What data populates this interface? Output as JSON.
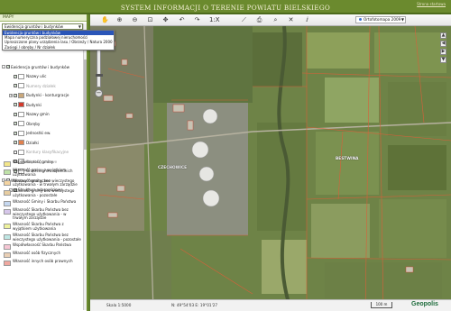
{
  "header": {
    "title": "SYSTEM INFORMACJI O TERENIE POWIATU BIELSKIEGO",
    "home_link": "Strona startowa"
  },
  "sidebar": {
    "tab": "MAPY",
    "selected_map": "Ewidencja gruntów i budynków",
    "options": [
      "Ewidencja gruntów i budynków",
      "Mapa numeryczna podziałowej nieruchomości",
      "Uproszczone plany urządzenia lasu / Obrzeży / Natura 2000",
      "Zasięgi / obręby / Nr działek"
    ],
    "tree": [
      {
        "level": 0,
        "label": "Ewidencja gruntów i budynków",
        "grey": false,
        "checked": true,
        "exp": "-",
        "swatch": ""
      },
      {
        "level": 1,
        "label": "Nazwy ulic",
        "grey": false,
        "checked": true,
        "exp": "",
        "swatch": "#ffffff"
      },
      {
        "level": 1,
        "label": "Numery działek",
        "grey": true,
        "checked": true,
        "exp": "",
        "swatch": "#ffffff"
      },
      {
        "level": 1,
        "label": "Budynki - konturgracje",
        "grey": false,
        "checked": true,
        "exp": "+",
        "swatch": "#c9a77a"
      },
      {
        "level": 1,
        "label": "Budynki",
        "grey": false,
        "checked": true,
        "exp": "",
        "swatch": "#d33a2c"
      },
      {
        "level": 1,
        "label": "Nazwy gmin",
        "grey": false,
        "checked": true,
        "exp": "",
        "swatch": "#ffffff"
      },
      {
        "level": 1,
        "label": "Obręby",
        "grey": false,
        "checked": true,
        "exp": "",
        "swatch": "#ffffff"
      },
      {
        "level": 1,
        "label": "Jednostki ew.",
        "grey": false,
        "checked": true,
        "exp": "",
        "swatch": "#ffffff"
      },
      {
        "level": 1,
        "label": "Działki",
        "grey": false,
        "checked": true,
        "exp": "",
        "swatch": "#e0814e"
      },
      {
        "level": 1,
        "label": "Kontury klasyfikacyjne",
        "grey": true,
        "checked": false,
        "exp": "",
        "swatch": "#ffffff"
      },
      {
        "level": 1,
        "label": "Użytki gruntowe",
        "grey": true,
        "checked": false,
        "exp": "",
        "swatch": "#ffffff"
      },
      {
        "level": 1,
        "label": "Granice gmin sąsiednich",
        "grey": false,
        "checked": true,
        "exp": "",
        "swatch": "#ffffff"
      },
      {
        "level": 0,
        "label": "Warstwy tematyczne",
        "grey": false,
        "checked": false,
        "exp": "-",
        "swatch": ""
      },
      {
        "level": 1,
        "label": "Struktura własnościowa",
        "grey": false,
        "checked": true,
        "exp": "-",
        "swatch": ""
      }
    ],
    "legend": [
      {
        "color": "#f3e68a",
        "label": "Współwłasność gminy"
      },
      {
        "color": "#bfe2a8",
        "label": "Własność gminy z wyjątkiem użytkowania"
      },
      {
        "color": "#f4d4a1",
        "label": "Własność gminy bez wieczystego użytkowania - w trwałym zarządzie"
      },
      {
        "color": "#e7cda1",
        "label": "Własność gminy bez wieczystego użytkowania - pozostałe"
      },
      {
        "color": "#c6d8f0",
        "label": "Własność Gminy i Skarbu Państwa"
      },
      {
        "color": "#d6c6ea",
        "label": "Własność Skarbu Państwa bez wieczystego użytkowania - w trwałym zarządzie"
      },
      {
        "color": "#eef29d",
        "label": "Własność Skarbu Państwa z wyjątkiem użytkowania"
      },
      {
        "color": "#bfe7e4",
        "label": "Własność Skarbu Państwa bez wieczystego użytkowania - pozostałe"
      },
      {
        "color": "#f7c7d5",
        "label": "Współwłasność Skarbu Państwa"
      },
      {
        "color": "#ead0b6",
        "label": "Własność osób fizycznych"
      },
      {
        "color": "#f0a8a0",
        "label": "Własność innych osób prawnych"
      }
    ]
  },
  "map": {
    "basemap": "Ortofotomapa 2009",
    "scale": "Skala 1:5000",
    "coords": "N: 49°54'03  E: 19°01'27",
    "scalebar": "100 m",
    "logo": "Geopolis",
    "labels": {
      "town": "CZECHOWICE",
      "village": "BESTWINA"
    },
    "copyright": "Geopolis"
  }
}
